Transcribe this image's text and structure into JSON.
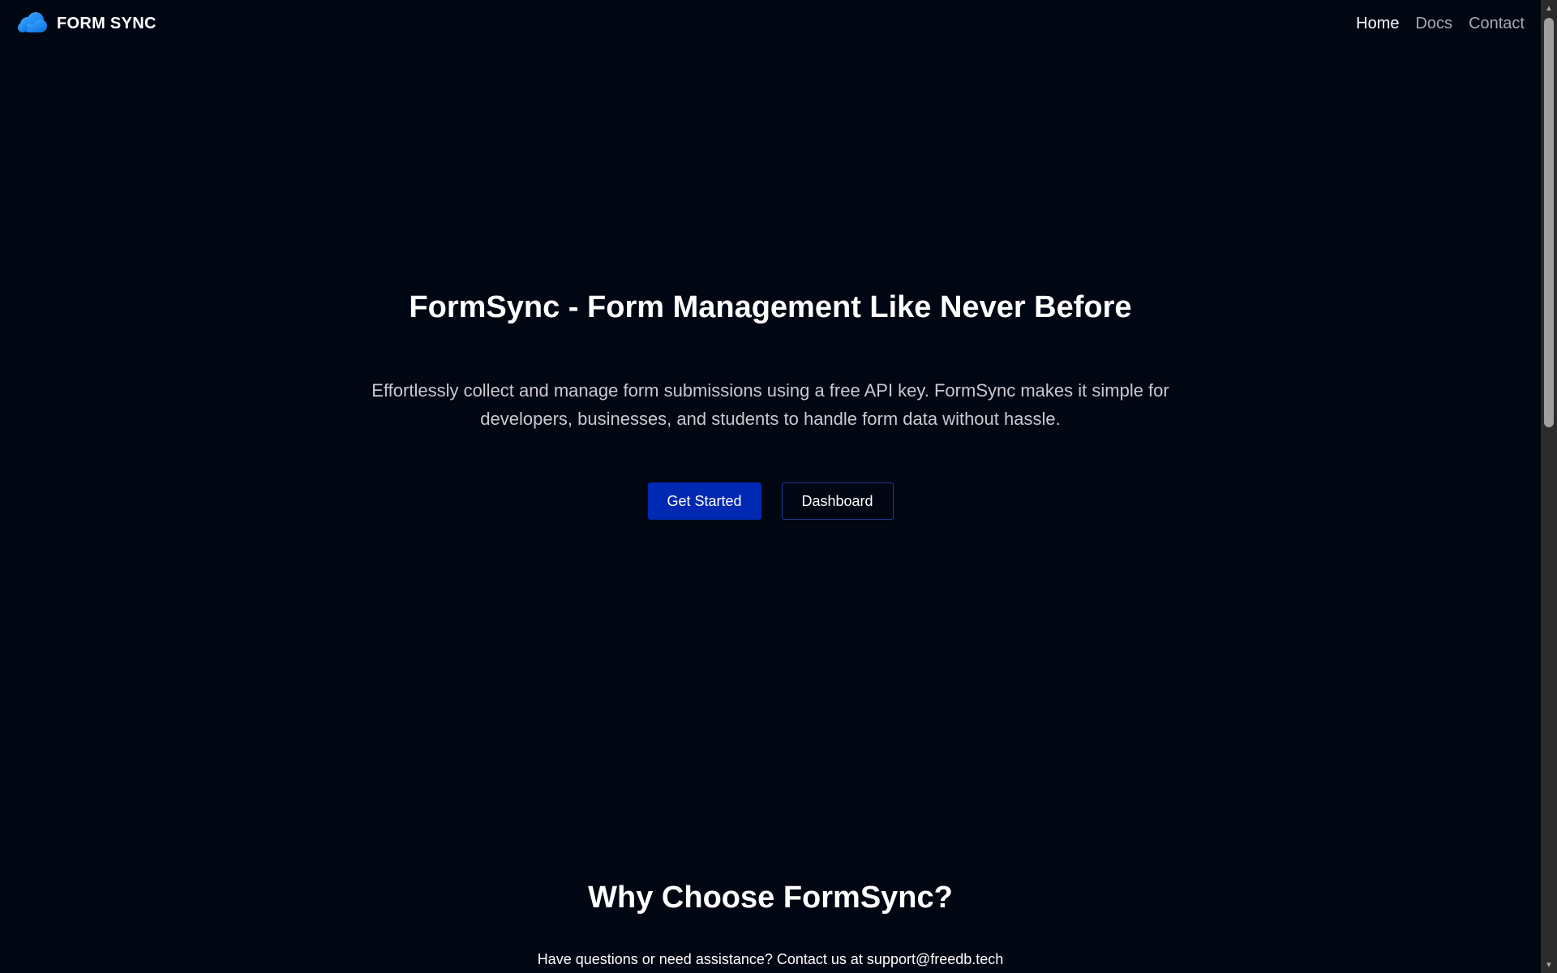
{
  "brand": {
    "name": "FORM SYNC",
    "logo_icon": "cloud-icon",
    "logo_color": "#1e90ff"
  },
  "nav": {
    "items": [
      {
        "label": "Home",
        "active": true
      },
      {
        "label": "Docs",
        "active": false
      },
      {
        "label": "Contact",
        "active": false
      }
    ]
  },
  "hero": {
    "title": "FormSync - Form Management Like Never Before",
    "subtitle": "Effortlessly collect and manage form submissions using a free API key. FormSync makes it simple for developers, businesses, and students to handle form data without hassle.",
    "primary_button": "Get Started",
    "secondary_button": "Dashboard"
  },
  "features": {
    "title": "Why Choose FormSync?"
  },
  "contact_note": "Have questions or need assistance? Contact us at support@freedb.tech",
  "colors": {
    "background": "#010613",
    "primary_button": "#0029b3",
    "secondary_border": "#1e3a9a"
  }
}
